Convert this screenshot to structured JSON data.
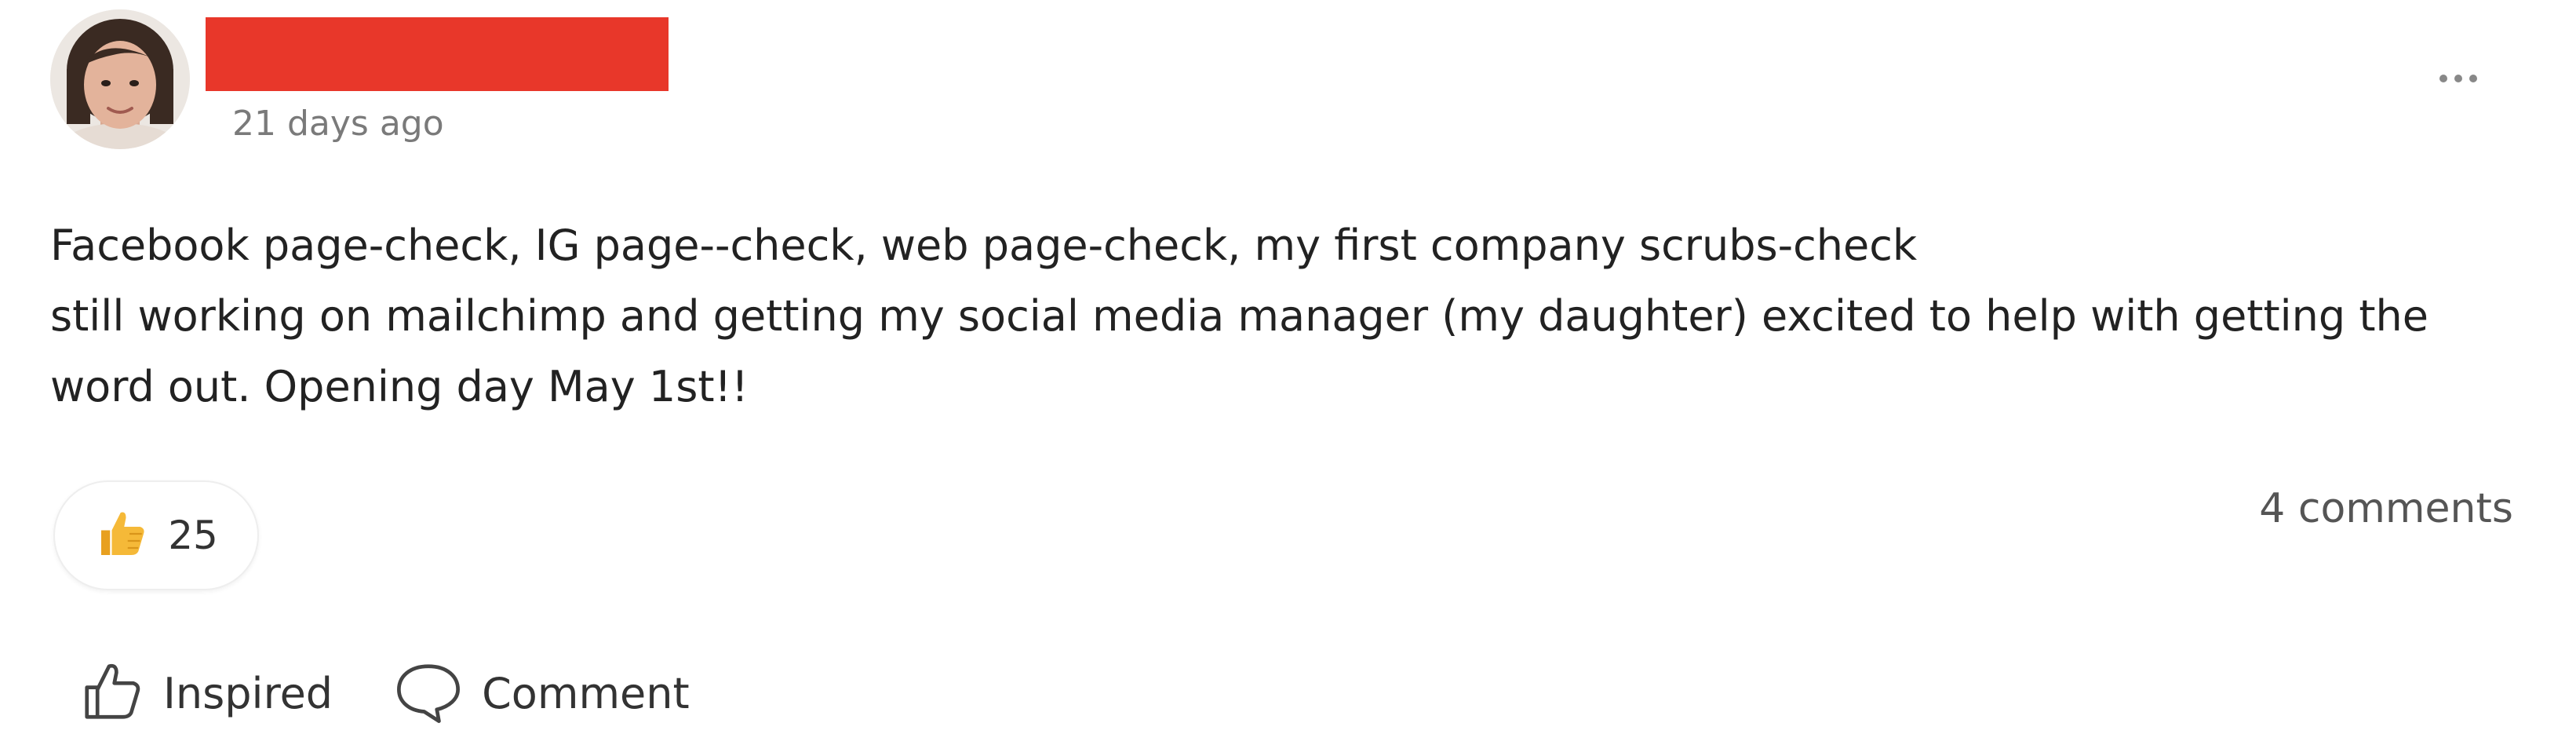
{
  "post": {
    "timestamp": "21 days ago",
    "body_lines": [
      "Facebook page-check, IG page--check, web page-check, my first company scrubs-check",
      "still working on mailchimp and getting my social media manager (my daughter) excited to help with getting the",
      "word out. Opening day May 1st!!"
    ],
    "author_name_redacted": true
  },
  "reactions": {
    "icon": "thumbs-up-emoji-icon",
    "count": "25"
  },
  "comments": {
    "count_label": "4 comments"
  },
  "actions": {
    "inspired_label": "Inspired",
    "comment_label": "Comment"
  },
  "colors": {
    "redaction": "#e8372a",
    "muted_text": "#7a7a7a",
    "emoji_yellow": "#f5b938"
  }
}
